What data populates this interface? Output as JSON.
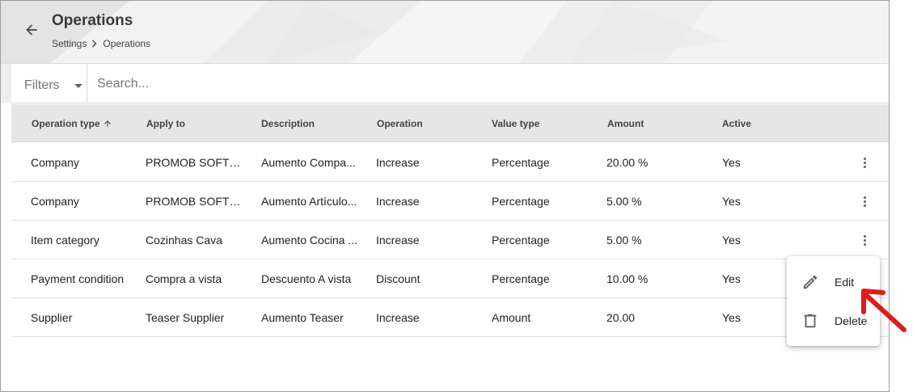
{
  "header": {
    "title": "Operations",
    "breadcrumb": [
      "Settings",
      "Operations"
    ],
    "back_icon": "arrow-left-icon"
  },
  "filterbar": {
    "filters_label": "Filters",
    "search_placeholder": "Search...",
    "search_value": ""
  },
  "table": {
    "columns": [
      "Operation type",
      "Apply to",
      "Description",
      "Operation",
      "Value type",
      "Amount",
      "Active"
    ],
    "sort_column": "Operation type",
    "sort_direction": "ascending",
    "rows": [
      [
        "Company",
        "PROMOB SOFTW...",
        "Aumento Compa...",
        "Increase",
        "Percentage",
        "20.00 %",
        "Yes"
      ],
      [
        "Company",
        "PROMOB SOFTW...",
        "Aumento Artículo...",
        "Increase",
        "Percentage",
        "5.00 %",
        "Yes"
      ],
      [
        "Item category",
        "Cozinhas Cava",
        "Aumento Cocina ...",
        "Increase",
        "Percentage",
        "5.00 %",
        "Yes"
      ],
      [
        "Payment condition",
        "Compra a vista",
        "Descuento A vista",
        "Discount",
        "Percentage",
        "10.00 %",
        "Yes"
      ],
      [
        "Supplier",
        "Teaser Supplier",
        "Aumento Teaser",
        "Increase",
        "Amount",
        "20.00",
        "Yes"
      ]
    ]
  },
  "context_menu": {
    "items": [
      {
        "label": "Edit",
        "icon": "pencil-icon"
      },
      {
        "label": "Delete",
        "icon": "trash-icon"
      }
    ]
  },
  "colors": {
    "annotation_arrow": "#e01b1b",
    "header_bg": "#efefef",
    "table_header_bg": "#e6e6e6"
  }
}
